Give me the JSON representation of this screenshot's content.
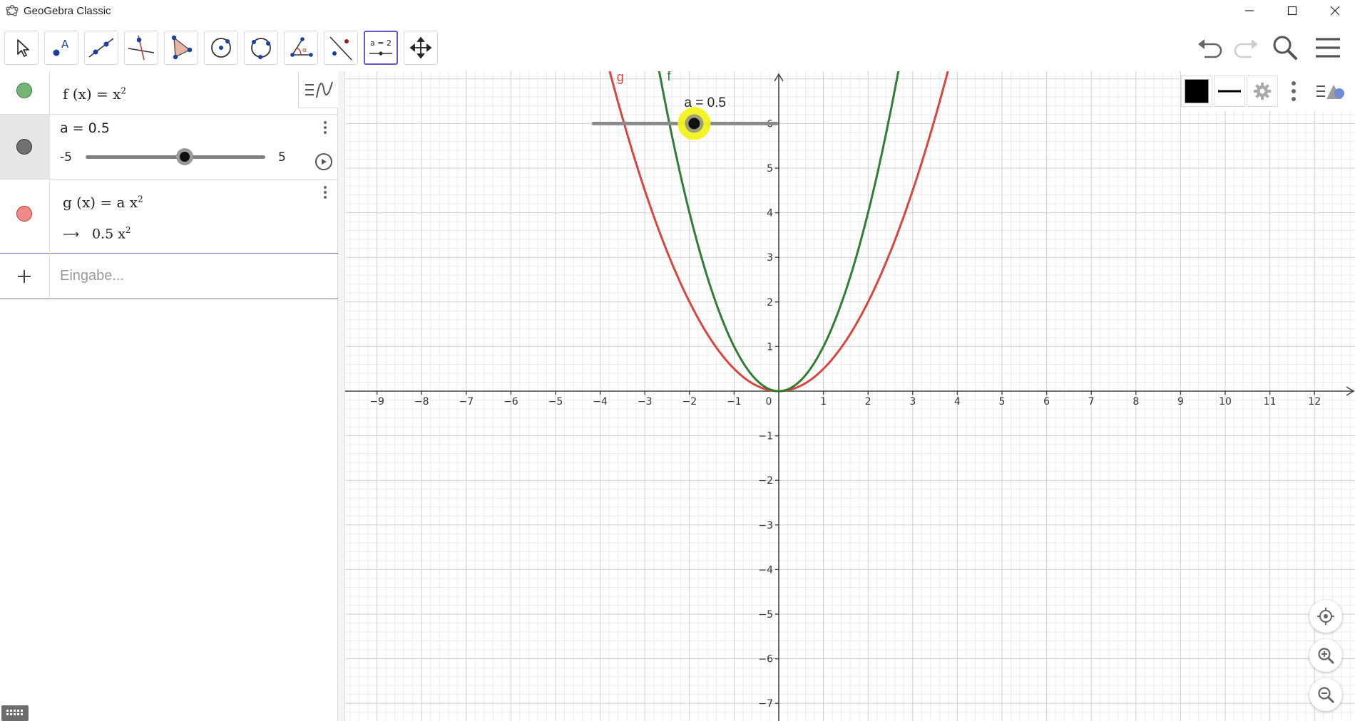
{
  "window": {
    "title": "GeoGebra Classic"
  },
  "toolbar": {
    "tools": [
      {
        "name": "move-tool"
      },
      {
        "name": "point-tool"
      },
      {
        "name": "line-tool"
      },
      {
        "name": "perpendicular-line-tool"
      },
      {
        "name": "polygon-tool"
      },
      {
        "name": "circle-center-point-tool"
      },
      {
        "name": "circle-through-three-points-tool"
      },
      {
        "name": "angle-tool"
      },
      {
        "name": "reflect-about-line-tool"
      },
      {
        "name": "slider-tool",
        "label": "a = 2"
      },
      {
        "name": "move-graphics-view-tool"
      }
    ]
  },
  "algebra": {
    "f": {
      "label": "f (x)  =  x",
      "exp": "2",
      "color": "#6aa56a"
    },
    "a": {
      "label": "a = 0.5",
      "min": "-5",
      "max": "5",
      "value": 0.5,
      "color": "#6e6e6e"
    },
    "g": {
      "label": "g (x)  =  a x",
      "exp": "2",
      "arrow": "⟶",
      "result": "0.5 x",
      "result_exp": "2",
      "color": "#e87d7d"
    },
    "input": {
      "placeholder": "Eingabe..."
    }
  },
  "graphics": {
    "slider_caption": "a = 0.5",
    "curve_labels": {
      "f": "f",
      "g": "g"
    },
    "x_ticks": [
      "−9",
      "−8",
      "−7",
      "−6",
      "−5",
      "−4",
      "−3",
      "−2",
      "−1",
      "0",
      "1",
      "2",
      "3",
      "4",
      "5",
      "6",
      "7",
      "8",
      "9",
      "10",
      "11",
      "12"
    ],
    "y_ticks": [
      "6",
      "5",
      "4",
      "3",
      "2",
      "1",
      "−1",
      "−2",
      "−3",
      "−4",
      "−5",
      "−6",
      "−7"
    ],
    "colors": {
      "f": "#2f7e34",
      "g": "#d9453f",
      "highlight": "#f2f21b"
    }
  }
}
